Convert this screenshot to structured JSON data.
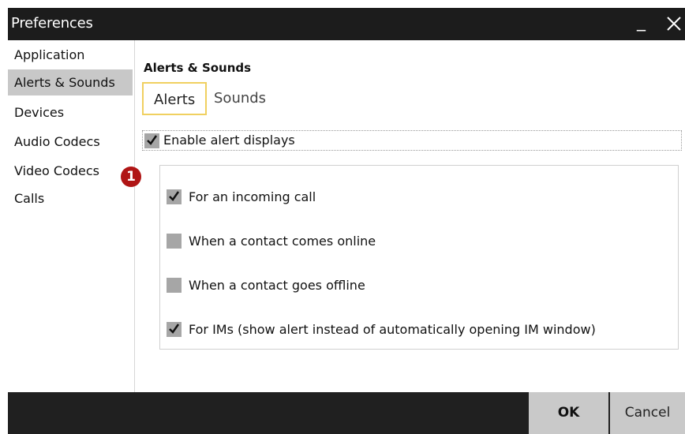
{
  "window": {
    "title": "Preferences"
  },
  "sidebar": {
    "items": [
      {
        "label": "Application"
      },
      {
        "label": "Alerts & Sounds"
      },
      {
        "label": "Devices"
      },
      {
        "label": "Audio Codecs"
      },
      {
        "label": "Video Codecs"
      },
      {
        "label": "Calls"
      }
    ],
    "selected": "Alerts & Sounds"
  },
  "panel": {
    "title": "Alerts & Sounds",
    "tabs": [
      {
        "label": "Alerts"
      },
      {
        "label": "Sounds"
      }
    ],
    "active_tab": "Alerts",
    "enable_alerts": {
      "label": "Enable alert displays",
      "checked": true
    },
    "options": [
      {
        "label": "For an incoming call",
        "checked": true
      },
      {
        "label": "When a contact comes online",
        "checked": false
      },
      {
        "label": "When a contact goes offline",
        "checked": false
      },
      {
        "label": "For IMs (show alert instead of automatically opening IM window)",
        "checked": true
      }
    ],
    "callout_badge": "1"
  },
  "footer": {
    "ok_label": "OK",
    "cancel_label": "Cancel"
  },
  "colors": {
    "titlebar": "#1c1c1c",
    "footer": "#202020",
    "selected": "#c8c8c8",
    "tab_border": "#f0d060",
    "badge": "#b01515",
    "checkbox": "#a6a6a6"
  }
}
